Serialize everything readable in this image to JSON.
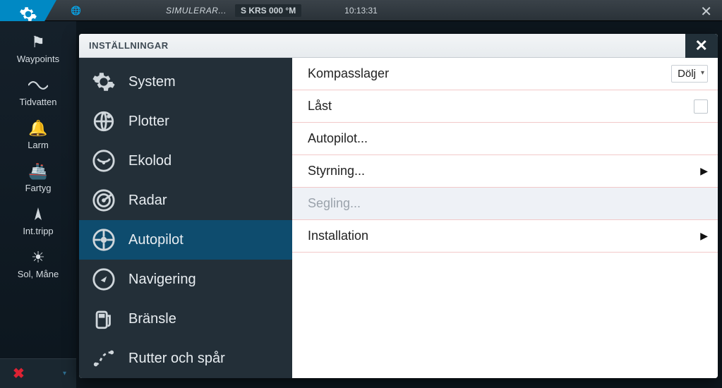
{
  "status": {
    "sim": "SIMULERAR...",
    "heading_prefix": "S",
    "heading_label": "KRS",
    "heading_value": "000",
    "heading_unit": "°M",
    "time": "10:13:31"
  },
  "sidebar": [
    {
      "id": "waypoints",
      "label": "Waypoints",
      "icon": "flag"
    },
    {
      "id": "tides",
      "label": "Tidvatten",
      "icon": "wave"
    },
    {
      "id": "alarm",
      "label": "Larm",
      "icon": "bell"
    },
    {
      "id": "vessels",
      "label": "Fartyg",
      "icon": "ship"
    },
    {
      "id": "trip",
      "label": "Int.tripp",
      "icon": "compass-tool"
    },
    {
      "id": "sunmoon",
      "label": "Sol, Måne",
      "icon": "sun"
    }
  ],
  "dialog": {
    "title": "INSTÄLLNINGAR",
    "categories": [
      {
        "id": "system",
        "label": "System",
        "icon": "gear"
      },
      {
        "id": "plotter",
        "label": "Plotter",
        "icon": "globe-marker"
      },
      {
        "id": "sonar",
        "label": "Ekolod",
        "icon": "sonar"
      },
      {
        "id": "radar",
        "label": "Radar",
        "icon": "radar"
      },
      {
        "id": "autopilot",
        "label": "Autopilot",
        "icon": "wheel",
        "active": true
      },
      {
        "id": "nav",
        "label": "Navigering",
        "icon": "compass"
      },
      {
        "id": "fuel",
        "label": "Bränsle",
        "icon": "fuel"
      },
      {
        "id": "routes",
        "label": "Rutter och spår",
        "icon": "route"
      }
    ],
    "detail": {
      "compass_bearing": {
        "label": "Kompasslager",
        "value": "Dölj"
      },
      "locked": {
        "label": "Låst",
        "checked": false
      },
      "autopilot": {
        "label": "Autopilot..."
      },
      "steering": {
        "label": "Styrning..."
      },
      "sailing": {
        "label": "Segling...",
        "disabled": true
      },
      "installation": {
        "label": "Installation"
      }
    }
  }
}
